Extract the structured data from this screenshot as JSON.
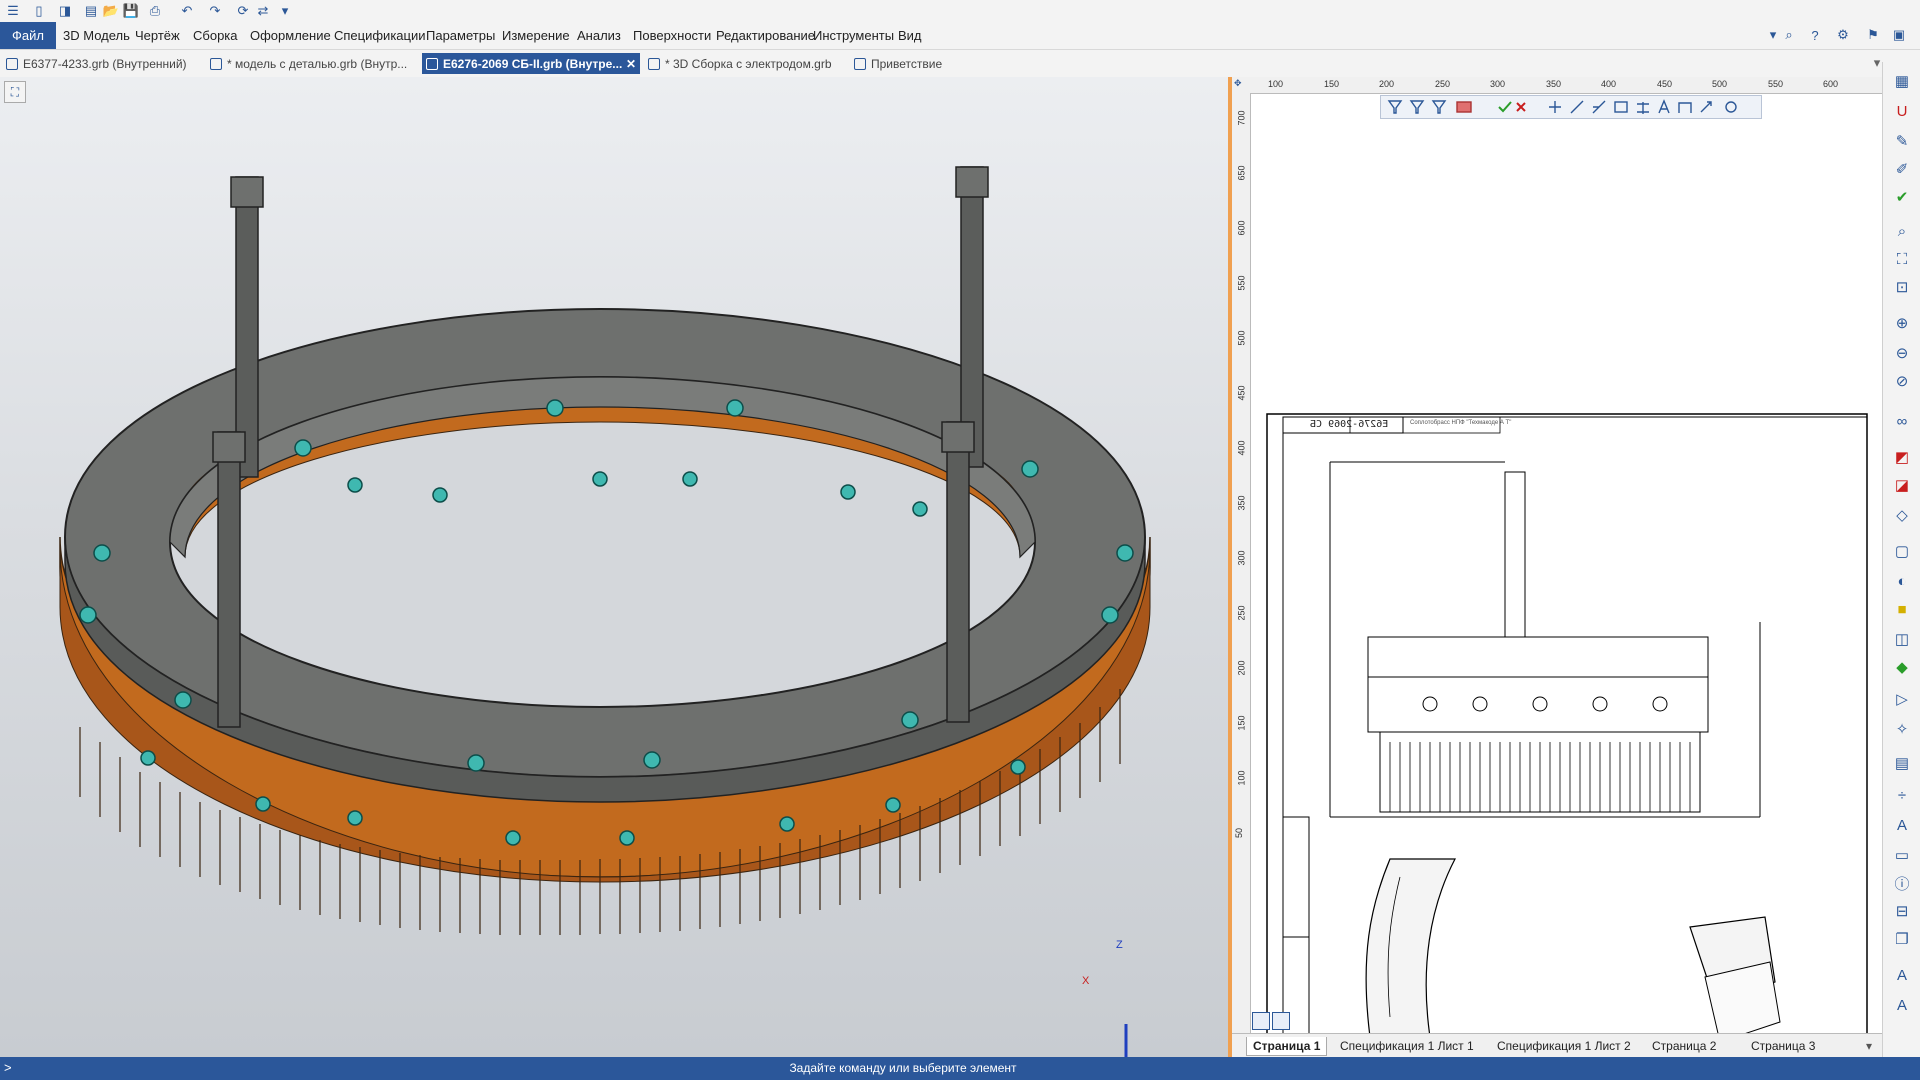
{
  "menu": {
    "file": "Файл",
    "items": [
      "3D Модель",
      "Чертёж",
      "Сборка",
      "Оформление",
      "Спецификации",
      "Параметры",
      "Измерение",
      "Анализ",
      "Поверхности",
      "Редактирование",
      "Инструменты",
      "Вид"
    ]
  },
  "tabs": [
    {
      "label": "E6377-4233.grb (Внутренний)",
      "active": false
    },
    {
      "label": "* модель с деталью.grb (Внутр...",
      "active": false
    },
    {
      "label": "E6276-2069 СБ-II.grb (Внутре...",
      "active": false
    },
    {
      "label": "* 3D Сборка с электродом.grb",
      "active": false
    },
    {
      "label": "Приветствие",
      "active": false
    }
  ],
  "active_tab_close": "✕",
  "ruler": {
    "top": [
      "100",
      "150",
      "200",
      "250",
      "300",
      "350",
      "400",
      "450",
      "500",
      "550",
      "600"
    ],
    "left": [
      "700",
      "650",
      "600",
      "550",
      "500",
      "450",
      "400",
      "350",
      "300",
      "250",
      "200",
      "150",
      "100",
      "50"
    ]
  },
  "drawing": {
    "title_block_code": "Е6276-2069 СБ",
    "company": "Соплотобрасс НПФ \"Техмакоде А Т\""
  },
  "axes": {
    "x": "X",
    "z": "Z"
  },
  "page_tabs": [
    "Страница 1",
    "Спецификация 1 Лист 1",
    "Спецификация 1 Лист 2",
    "Страница 2",
    "Страница 3"
  ],
  "status": {
    "prompt": ">",
    "text": "Задайте команду или выберите элемент"
  },
  "colors": {
    "accent": "#2b579a",
    "splitter": "#f0a050",
    "copper": "#c26a1e",
    "steel": "#6e706e",
    "bolt": "#3fb8b0"
  }
}
